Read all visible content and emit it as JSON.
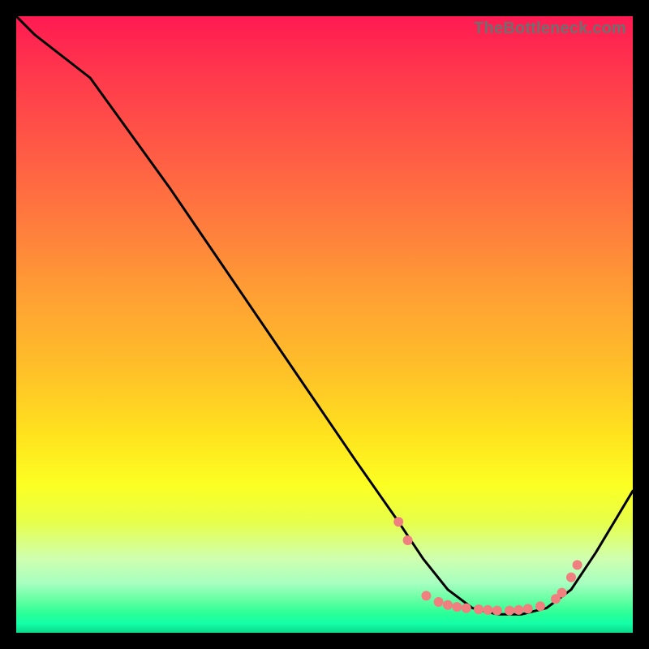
{
  "watermark": "TheBottleneck.com",
  "chart_data": {
    "type": "line",
    "title": "",
    "xlabel": "",
    "ylabel": "",
    "xlim": [
      0,
      100
    ],
    "ylim": [
      0,
      100
    ],
    "grid": false,
    "legend": false,
    "series": [
      {
        "name": "curve",
        "x": [
          0,
          3,
          12,
          25,
          40,
          55,
          62,
          66,
          70,
          74,
          78,
          82,
          86,
          90,
          94,
          100
        ],
        "y": [
          100,
          97,
          90,
          72,
          50,
          28,
          18,
          12,
          7,
          4,
          3,
          3,
          4,
          7,
          13,
          23
        ]
      }
    ],
    "markers": {
      "name": "dots",
      "color": "#f08080",
      "points": [
        {
          "x": 62.0,
          "y": 18.0
        },
        {
          "x": 63.5,
          "y": 15.0
        },
        {
          "x": 66.5,
          "y": 6.0
        },
        {
          "x": 68.5,
          "y": 5.0
        },
        {
          "x": 70.0,
          "y": 4.5
        },
        {
          "x": 71.5,
          "y": 4.2
        },
        {
          "x": 73.0,
          "y": 4.0
        },
        {
          "x": 75.0,
          "y": 3.8
        },
        {
          "x": 76.5,
          "y": 3.7
        },
        {
          "x": 78.0,
          "y": 3.6
        },
        {
          "x": 80.0,
          "y": 3.6
        },
        {
          "x": 81.5,
          "y": 3.7
        },
        {
          "x": 83.0,
          "y": 3.9
        },
        {
          "x": 85.0,
          "y": 4.3
        },
        {
          "x": 87.5,
          "y": 5.5
        },
        {
          "x": 88.5,
          "y": 6.5
        },
        {
          "x": 90.0,
          "y": 9.0
        },
        {
          "x": 91.0,
          "y": 11.0
        }
      ]
    },
    "background_gradient": {
      "stops": [
        {
          "pos": 0.0,
          "color": "#ff1a52"
        },
        {
          "pos": 0.22,
          "color": "#ff5b45"
        },
        {
          "pos": 0.46,
          "color": "#ffa233"
        },
        {
          "pos": 0.68,
          "color": "#ffe31e"
        },
        {
          "pos": 0.82,
          "color": "#e7ff4a"
        },
        {
          "pos": 0.95,
          "color": "#5cffa0"
        },
        {
          "pos": 1.0,
          "color": "#0bd98a"
        }
      ]
    }
  }
}
